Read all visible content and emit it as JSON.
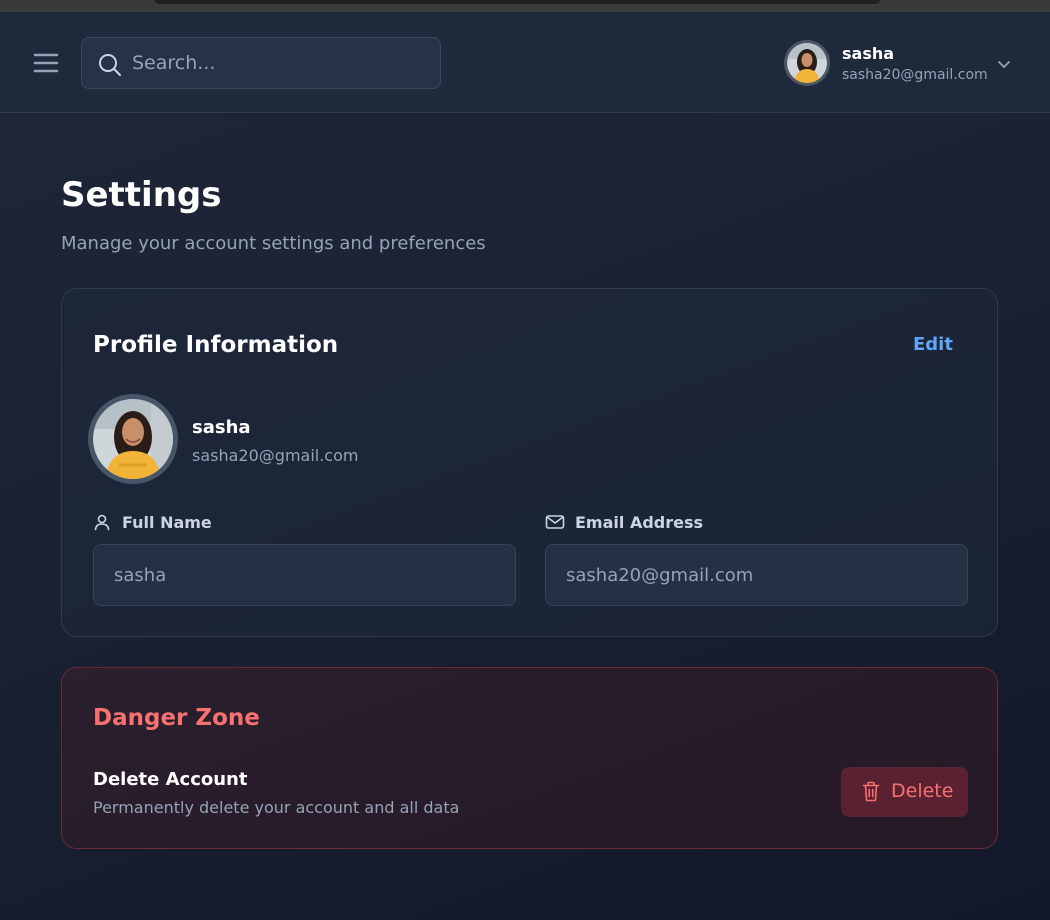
{
  "header": {
    "search_placeholder": "Search...",
    "user": {
      "name": "sasha",
      "email": "sasha20@gmail.com"
    },
    "icons": [
      "menu-icon",
      "search-icon",
      "chevron-down-icon"
    ]
  },
  "page": {
    "title": "Settings",
    "subtitle": "Manage your account settings and preferences"
  },
  "profile": {
    "section_title": "Profile Information",
    "edit_label": "Edit",
    "name": "sasha",
    "email": "sasha20@gmail.com",
    "full_name_label": "Full Name",
    "full_name_value": "sasha",
    "email_label": "Email Address",
    "email_value": "sasha20@gmail.com"
  },
  "danger_zone": {
    "title": "Danger Zone",
    "item_title": "Delete Account",
    "item_description": "Permanently delete your account and all data",
    "delete_label": "Delete"
  },
  "colors": {
    "accent": "#60a5fa",
    "danger": "#f87171",
    "background": "#1a2234"
  }
}
